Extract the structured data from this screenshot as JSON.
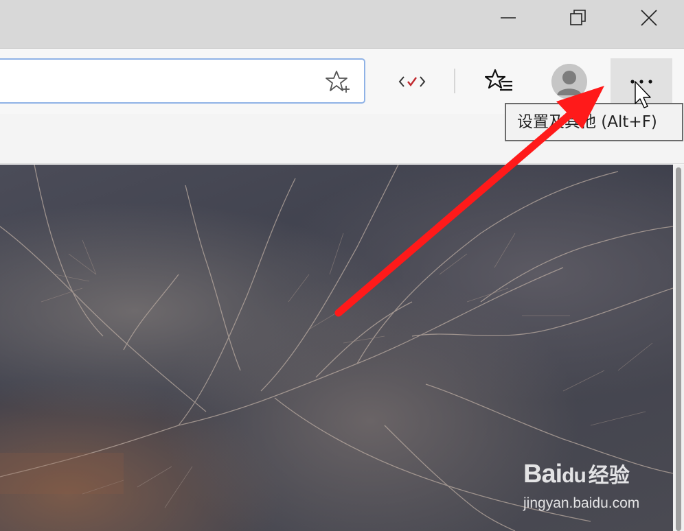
{
  "window_controls": {
    "minimize_icon": "minimize-icon",
    "maximize_icon": "restore-icon",
    "close_icon": "close-icon"
  },
  "address_bar": {
    "value": "",
    "favorite_icon": "star-add-icon"
  },
  "toolbar": {
    "reading_icon": "code-check-icon",
    "hub_icon": "favorites-list-icon",
    "profile_icon": "avatar-icon",
    "more_icon": "more-dots-icon"
  },
  "tooltip": {
    "text": "设置及其他 (Alt+F)"
  },
  "annotation": {
    "arrow_color": "#ff1a1a"
  },
  "watermark": {
    "brand": "Bai",
    "brand_mid": "du",
    "brand_cn": "经验",
    "url": "jingyan.baidu.com"
  },
  "colors": {
    "accent_border": "#8fb2e6",
    "titlebar": "#d8d8d8",
    "toolbar": "#f7f7f7"
  }
}
